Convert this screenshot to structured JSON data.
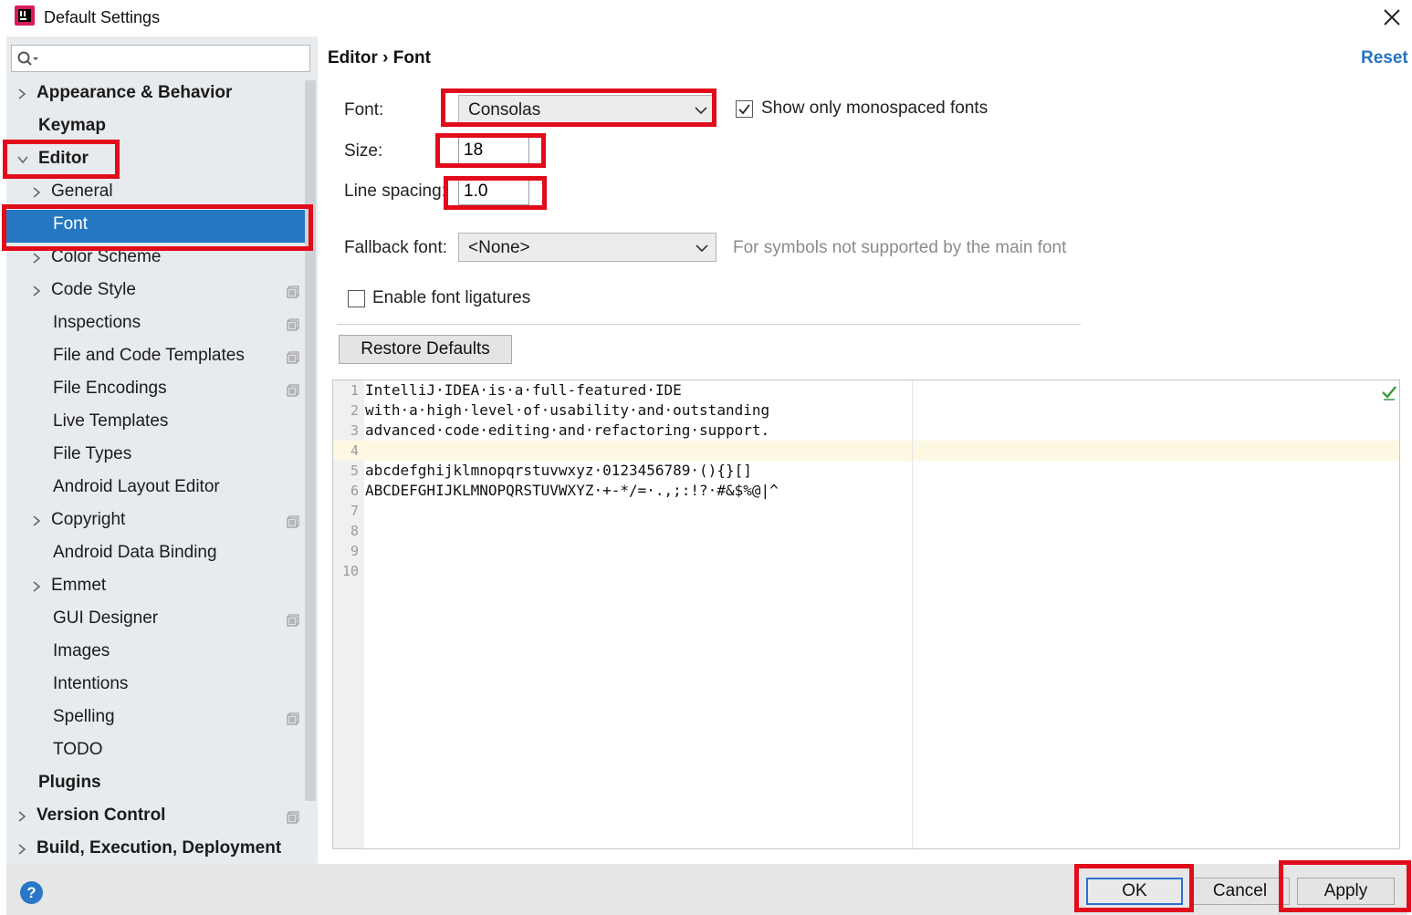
{
  "window": {
    "title": "Default Settings"
  },
  "search": {
    "placeholder": ""
  },
  "tree": {
    "appearance": "Appearance & Behavior",
    "keymap": "Keymap",
    "editor": "Editor",
    "general": "General",
    "font": "Font",
    "color_scheme": "Color Scheme",
    "code_style": "Code Style",
    "inspections": "Inspections",
    "file_code_templates": "File and Code Templates",
    "file_encodings": "File Encodings",
    "live_templates": "Live Templates",
    "file_types": "File Types",
    "android_layout_editor": "Android Layout Editor",
    "copyright": "Copyright",
    "android_data_binding": "Android Data Binding",
    "emmet": "Emmet",
    "gui_designer": "GUI Designer",
    "images": "Images",
    "intentions": "Intentions",
    "spelling": "Spelling",
    "todo": "TODO",
    "plugins": "Plugins",
    "version_control": "Version Control",
    "build": "Build, Execution, Deployment"
  },
  "header": {
    "breadcrumb": "Editor › Font",
    "reset": "Reset"
  },
  "form": {
    "font_label": "Font:",
    "font_value": "Consolas",
    "mono_label": "Show only monospaced fonts",
    "mono_checked": true,
    "size_label": "Size:",
    "size_value": "18",
    "spacing_label": "Line spacing:",
    "spacing_value": "1.0",
    "fallback_label": "Fallback font:",
    "fallback_value": "<None>",
    "fallback_hint": "For symbols not supported by the main font",
    "ligatures_label": "Enable font ligatures",
    "ligatures_checked": false,
    "restore": "Restore Defaults"
  },
  "preview": {
    "lines": [
      {
        "n": "1",
        "t": "IntelliJ·IDEA·is·a·full-featured·IDE"
      },
      {
        "n": "2",
        "t": "with·a·high·level·of·usability·and·outstanding"
      },
      {
        "n": "3",
        "t": "advanced·code·editing·and·refactoring·support."
      },
      {
        "n": "4",
        "t": ""
      },
      {
        "n": "5",
        "t": "abcdefghijklmnopqrstuvwxyz·0123456789·(){}[]"
      },
      {
        "n": "6",
        "t": "ABCDEFGHIJKLMNOPQRSTUVWXYZ·+-*/=·.,;:!?·#&$%@|^"
      },
      {
        "n": "7",
        "t": ""
      },
      {
        "n": "8",
        "t": ""
      },
      {
        "n": "9",
        "t": ""
      },
      {
        "n": "10",
        "t": ""
      }
    ]
  },
  "footer": {
    "help": "?",
    "ok": "OK",
    "cancel": "Cancel",
    "apply": "Apply"
  },
  "colors": {
    "selection": "#2577c2",
    "highlight": "#e10b1b",
    "link": "#2672c4"
  }
}
